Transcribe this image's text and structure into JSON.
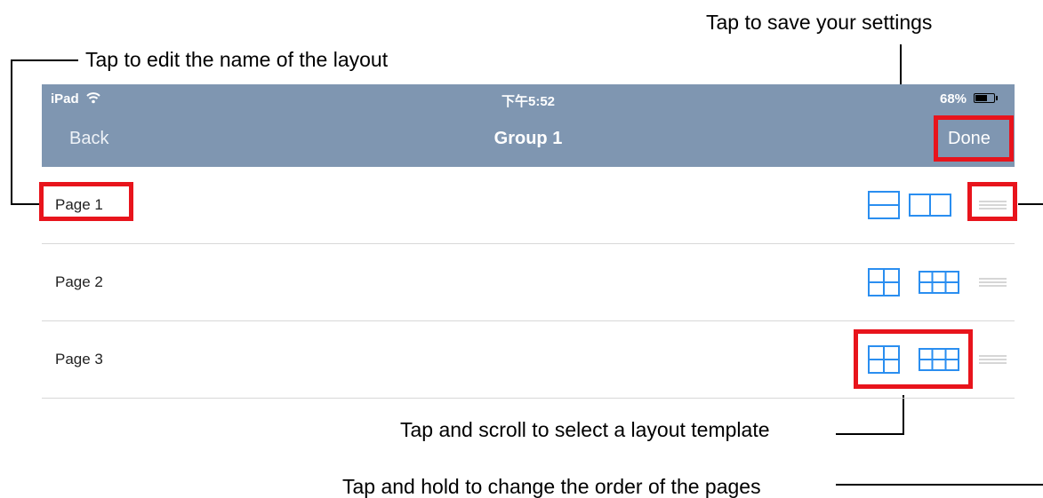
{
  "annotations": {
    "edit_name": "Tap to edit the name of the layout",
    "save": "Tap to save your settings",
    "select_template": "Tap and scroll to select a layout template",
    "reorder": "Tap and hold to change the order of the pages"
  },
  "status_bar": {
    "device": "iPad",
    "time": "下午5:52",
    "battery": "68%",
    "battery_level": 0.68
  },
  "nav": {
    "back_label": "Back",
    "title": "Group 1",
    "done_label": "Done"
  },
  "pages": [
    {
      "name": "Page 1",
      "templates": [
        "two-rows-icon",
        "two-columns-icon"
      ]
    },
    {
      "name": "Page 2",
      "templates": [
        "grid-2x2-icon",
        "grid-2x3-icon"
      ]
    },
    {
      "name": "Page 3",
      "templates": [
        "grid-2x2-icon",
        "grid-2x3-icon"
      ]
    }
  ],
  "colors": {
    "navbar": "#7f96b1",
    "template_icon": "#2a8ef0",
    "highlight": "#e8141c",
    "grip": "#c8c8c8"
  }
}
